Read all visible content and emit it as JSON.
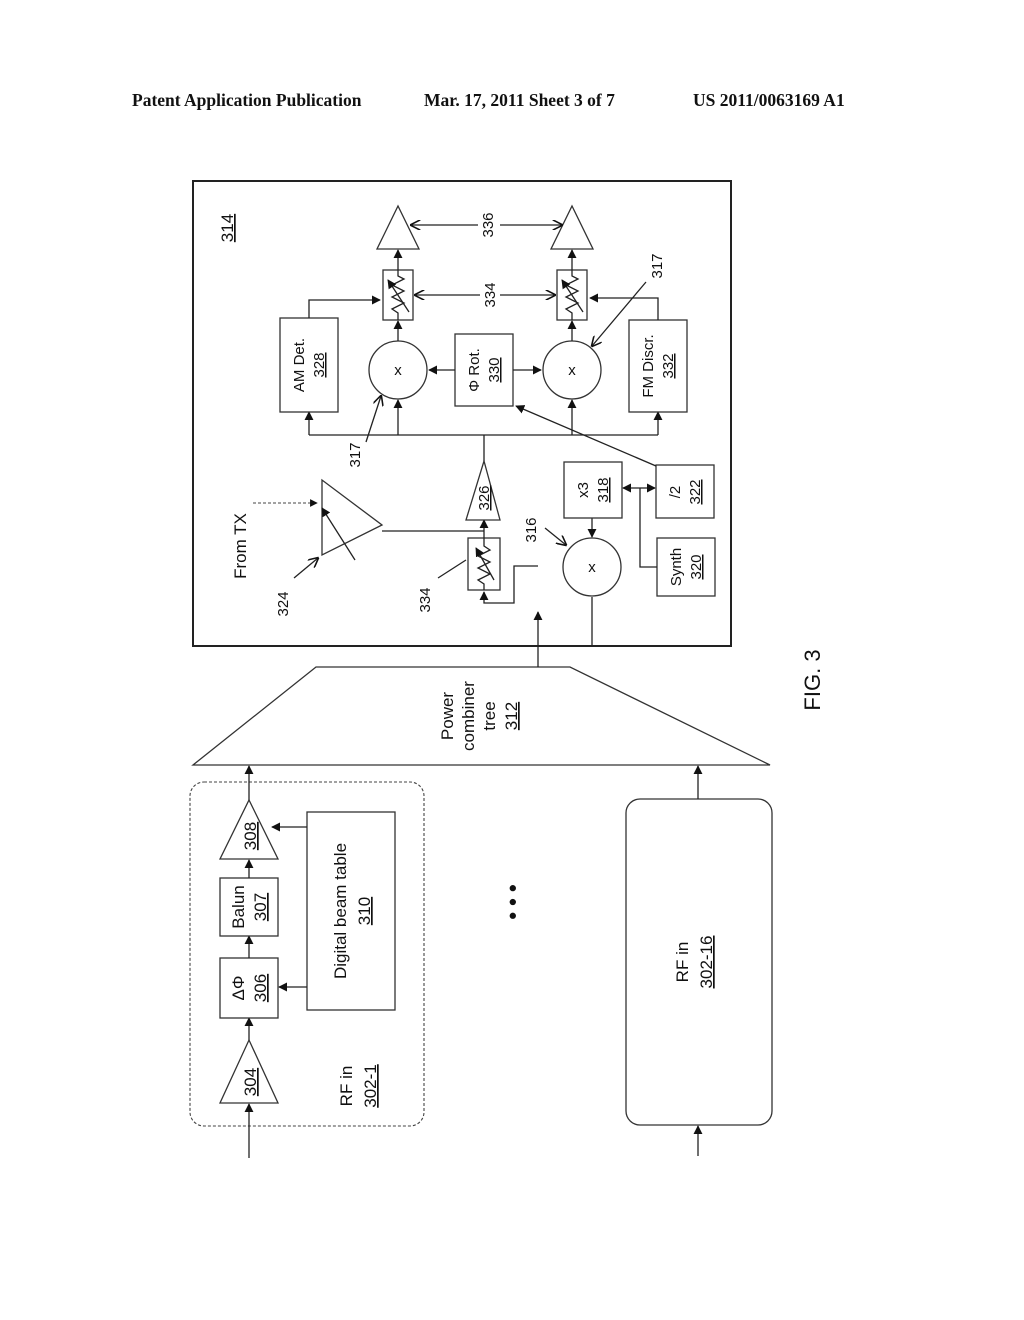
{
  "header": {
    "publication": "Patent Application Publication",
    "date_sheet": "Mar. 17, 2011  Sheet 3 of 7",
    "number": "US 2011/0063169 A1"
  },
  "figure": {
    "label": "FIG. 3",
    "orientation": "rotated 90° counter-clockwise",
    "rf_in_1": {
      "label": "RF in",
      "ref": "302-1"
    },
    "rf_in_16": {
      "label": "RF in",
      "ref": "302-16"
    },
    "amp_304": {
      "ref": "304"
    },
    "phase_shifter": {
      "label": "ΔΦ",
      "ref": "306"
    },
    "balun": {
      "label": "Balun",
      "ref": "307"
    },
    "amp_308": {
      "ref": "308"
    },
    "beam_table": {
      "label": "Digital beam table",
      "ref": "310"
    },
    "ellipsis": "• • •",
    "combiner": {
      "line1": "Power",
      "line2": "combiner",
      "line3": "tree",
      "ref": "312"
    },
    "module_ref": "314",
    "mixer_316": {
      "symbol": "x",
      "ref": "316"
    },
    "mixer_317": {
      "symbol": "x",
      "ref": "317"
    },
    "mult": {
      "label": "x3",
      "ref": "318"
    },
    "synth": {
      "label": "Synth",
      "ref": "320"
    },
    "divider": {
      "label": "/2",
      "ref": "322"
    },
    "var_amp": {
      "input_label": "From TX",
      "ref": "324"
    },
    "amp_326": {
      "ref": "326"
    },
    "am_det": {
      "label": "AM Det.",
      "ref": "328"
    },
    "phi_rot": {
      "label": "Φ Rot.",
      "ref": "330"
    },
    "fm_discr": {
      "label": "FM Discr.",
      "ref": "332"
    },
    "attenuator_ref": "334",
    "output_amp_ref": "336"
  }
}
